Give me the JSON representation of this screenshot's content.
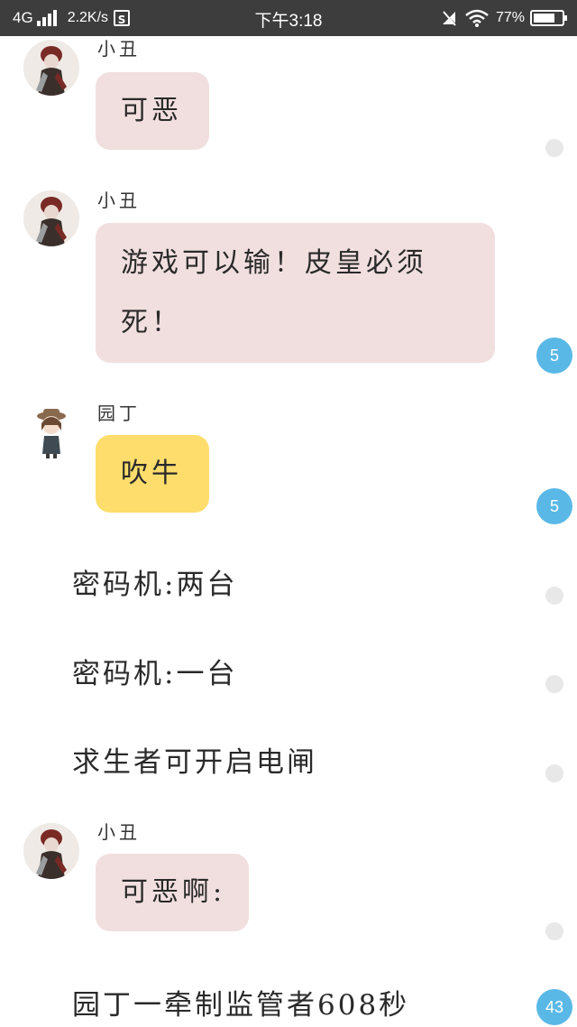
{
  "status_bar": {
    "network": "4G",
    "speed": "2.2K/s",
    "s_badge": "S",
    "time": "下午3:18",
    "battery_percent": "77%",
    "battery_level": 0.77,
    "icons": [
      "signal-icon",
      "sim-s-icon",
      "mute-icon",
      "wifi-icon",
      "battery-icon"
    ]
  },
  "colors": {
    "status_bar_bg": "#3d3d3d",
    "pink_bubble": "#f1dfdf",
    "yellow_bubble": "#fedd6c",
    "badge_blue": "#5ab8e6",
    "dot_gray": "#e8e8e8"
  },
  "messages": [
    {
      "speaker": "小丑",
      "text": "可恶"
    },
    {
      "speaker": "小丑",
      "text_line1": "游戏可以输！皮皇必须",
      "text_line2": "死！",
      "comment_count": "5"
    },
    {
      "speaker": "园丁",
      "text": "吹牛",
      "comment_count": "5"
    },
    {
      "text": "密码机:两台"
    },
    {
      "text": "密码机:一台"
    },
    {
      "text": "求生者可开启电闸"
    },
    {
      "speaker": "小丑",
      "text": "可恶啊:"
    },
    {
      "text": "园丁一牵制监管者608秒",
      "comment_count": "43"
    }
  ]
}
